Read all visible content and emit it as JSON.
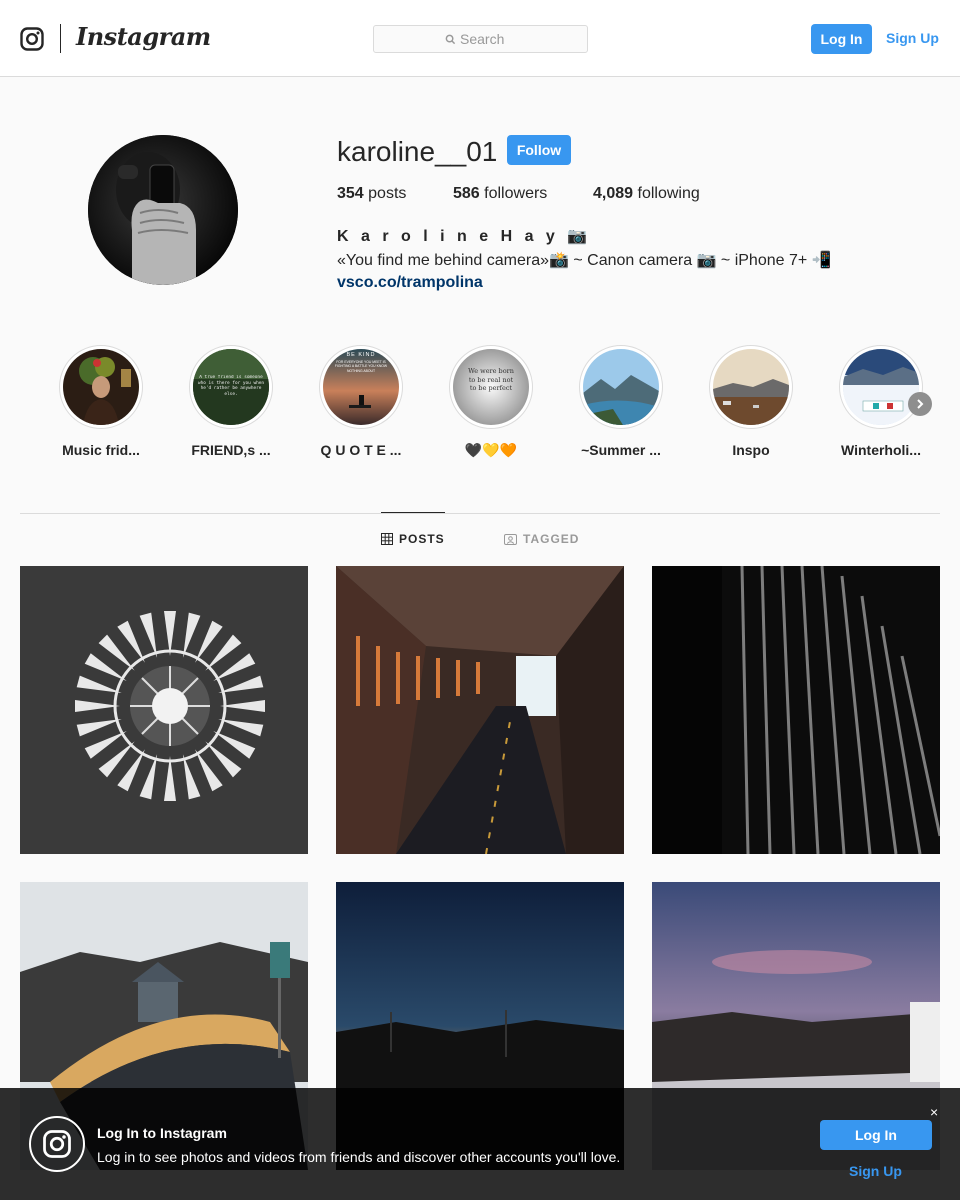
{
  "header": {
    "brand": "Instagram",
    "search_placeholder": "Search",
    "login_label": "Log In",
    "signup_label": "Sign Up"
  },
  "profile": {
    "username": "karoline__01",
    "follow_label": "Follow",
    "posts_count": "354",
    "posts_label": "posts",
    "followers_count": "586",
    "followers_label": "followers",
    "following_count": "4,089",
    "following_label": "following",
    "full_name": "K a r o l i n e H a y 📷",
    "bio": "«You find me behind camera»📸 ~ Canon camera 📷 ~ iPhone 7+ 📲",
    "link": "vsco.co/trampolina"
  },
  "highlights": [
    {
      "label": "Music frid..."
    },
    {
      "label": "FRIEND,s ..."
    },
    {
      "label": "Q U O T E ..."
    },
    {
      "label": "🖤💛🧡"
    },
    {
      "label": "~Summer ..."
    },
    {
      "label": "Inspo"
    },
    {
      "label": "Winterholi..."
    }
  ],
  "highlight_texts": {
    "friend": "A true friend is someone who is there for you when he'd rather be anywhere else.",
    "kind_title": "BE KIND",
    "kind_body": "FOR EVERYONE YOU MEET IS FIGHTING A BATTLE YOU KNOW NOTHING ABOUT",
    "born": "We were born to be real not to be perfect"
  },
  "tabs": {
    "posts": "POSTS",
    "tagged": "TAGGED"
  },
  "banner": {
    "title": "Log In to Instagram",
    "text": "Log in to see photos and videos from friends and discover other accounts you'll love.",
    "login_label": "Log In",
    "signup_label": "Sign Up",
    "close": "×"
  },
  "colors": {
    "accent": "#3897f0",
    "link": "#003569",
    "text": "#262626",
    "border": "#dbdbdb",
    "background": "#fafafa"
  }
}
